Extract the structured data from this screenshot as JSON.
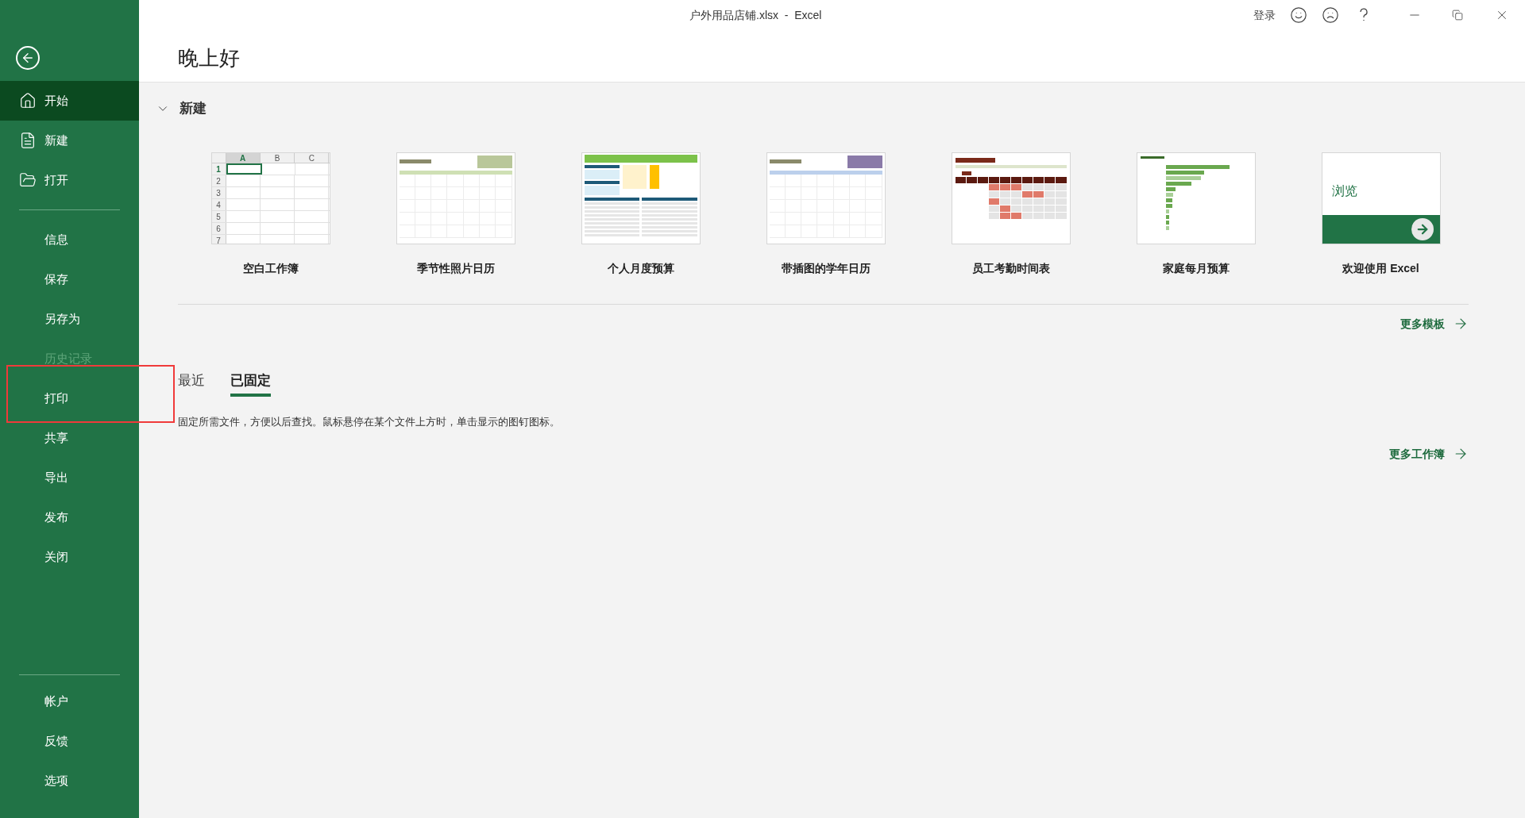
{
  "title_bar": {
    "title": "户外用品店铺.xlsx  -  Excel",
    "sign_in": "登录"
  },
  "sidebar": {
    "top_items": [
      {
        "label": "开始",
        "selected": true,
        "disabled": false
      },
      {
        "label": "新建",
        "selected": false,
        "disabled": false
      },
      {
        "label": "打开",
        "selected": false,
        "disabled": false
      }
    ],
    "middle_items": [
      {
        "label": "信息",
        "selected": false,
        "disabled": false
      },
      {
        "label": "保存",
        "selected": false,
        "disabled": false
      },
      {
        "label": "另存为",
        "selected": false,
        "disabled": false
      },
      {
        "label": "历史记录",
        "selected": false,
        "disabled": true
      },
      {
        "label": "打印",
        "selected": false,
        "disabled": false
      },
      {
        "label": "共享",
        "selected": false,
        "disabled": false
      },
      {
        "label": "导出",
        "selected": false,
        "disabled": false
      },
      {
        "label": "发布",
        "selected": false,
        "disabled": false
      },
      {
        "label": "关闭",
        "selected": false,
        "disabled": false
      }
    ],
    "bottom_items": [
      {
        "label": "帐户",
        "selected": false,
        "disabled": false
      },
      {
        "label": "反馈",
        "selected": false,
        "disabled": false
      },
      {
        "label": "选项",
        "selected": false,
        "disabled": false
      }
    ]
  },
  "greeting": "晚上好",
  "new_section": {
    "title": "新建",
    "expanded": true,
    "templates": [
      {
        "kind": "blank",
        "label": "空白工作簿",
        "columns": [
          "A",
          "B",
          "C"
        ],
        "rows": [
          "1",
          "2",
          "3",
          "4",
          "5",
          "6",
          "7"
        ]
      },
      {
        "kind": "calendar",
        "label": "季节性照片日历"
      },
      {
        "kind": "budget",
        "label": "个人月度预算"
      },
      {
        "kind": "schoolcal",
        "label": "带插图的学年日历"
      },
      {
        "kind": "timesheet",
        "label": "员工考勤时间表"
      },
      {
        "kind": "chart",
        "label": "家庭每月预算"
      },
      {
        "kind": "browse",
        "label": "欢迎使用 Excel",
        "tile_text": "浏览"
      }
    ],
    "more_link": "更多模板"
  },
  "files": {
    "tabs": [
      {
        "label": "最近",
        "selected": false
      },
      {
        "label": "已固定",
        "selected": true
      }
    ],
    "hint": "固定所需文件，方便以后查找。鼠标悬停在某个文件上方时，单击显示的图钉图标。",
    "more_link": "更多工作簿"
  }
}
